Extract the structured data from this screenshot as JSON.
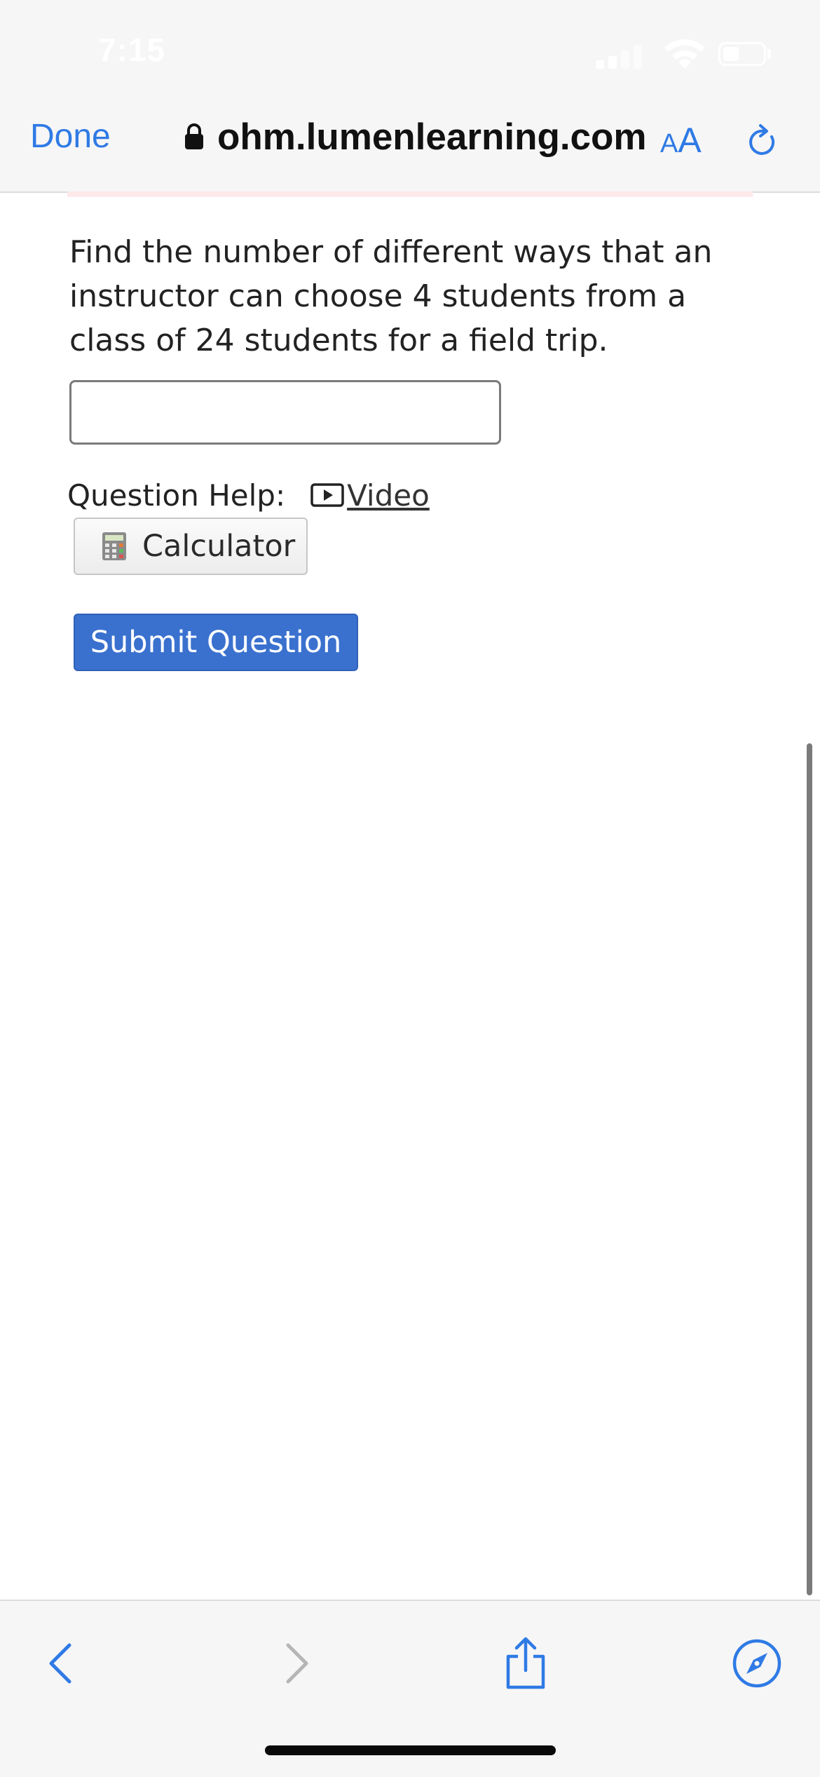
{
  "status_bar": {
    "time": "7:15"
  },
  "browser": {
    "done_label": "Done",
    "url": "ohm.lumenlearning.com",
    "text_size_label_small": "A",
    "text_size_label_big": "A"
  },
  "question": {
    "text": "Find the number of different ways that an instructor can choose 4 students from a class of 24 students for a field trip.",
    "answer_value": "",
    "help_label": "Question Help:",
    "video_link": "Video",
    "calculator_button": "Calculator",
    "submit_button": "Submit Question"
  },
  "toolbar": {
    "icons": [
      "back-icon",
      "forward-icon",
      "share-icon",
      "compass-icon"
    ]
  },
  "colors": {
    "accent": "#2f7ae5",
    "submit": "#3a71cf",
    "chrome_bg": "#f6f6f6"
  }
}
